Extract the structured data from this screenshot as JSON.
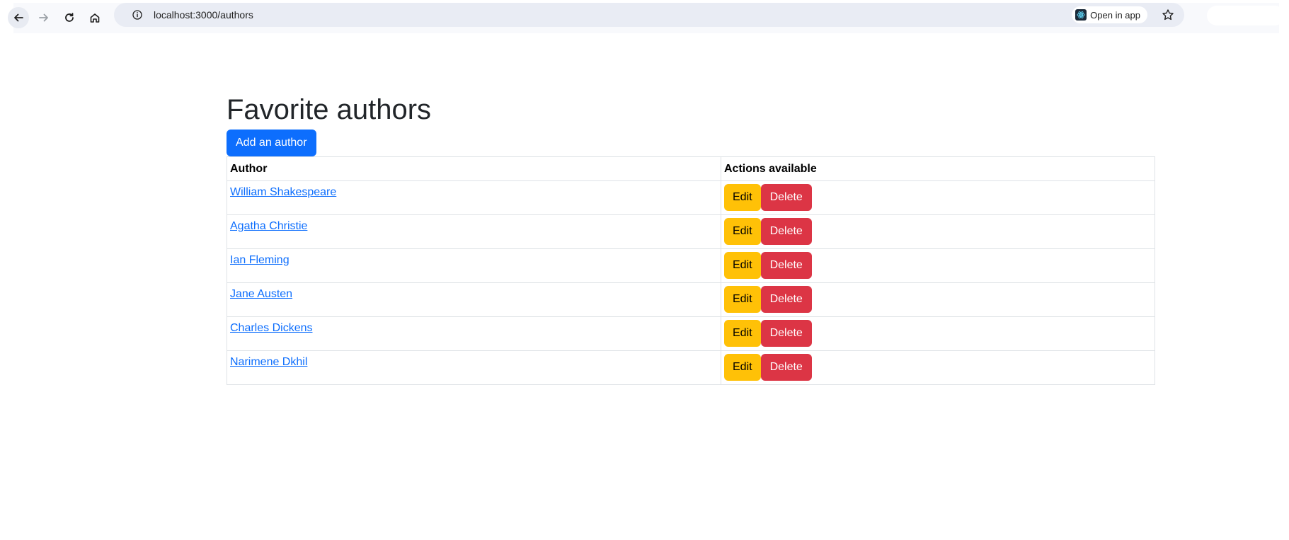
{
  "browser": {
    "url": "localhost:3000/authors",
    "open_in_app_label": "Open in app"
  },
  "page": {
    "title": "Favorite authors",
    "add_button_label": "Add an author"
  },
  "table": {
    "headers": [
      "Author",
      "Actions available"
    ],
    "rows": [
      {
        "author": "William Shakespeare",
        "edit": "Edit",
        "delete": "Delete"
      },
      {
        "author": "Agatha Christie",
        "edit": "Edit",
        "delete": "Delete"
      },
      {
        "author": "Ian Fleming",
        "edit": "Edit",
        "delete": "Delete"
      },
      {
        "author": "Jane Austen",
        "edit": "Edit",
        "delete": "Delete"
      },
      {
        "author": "Charles Dickens",
        "edit": "Edit",
        "delete": "Delete"
      },
      {
        "author": "Narimene Dkhil",
        "edit": "Edit",
        "delete": "Delete"
      }
    ]
  },
  "colors": {
    "primary": "#0d6efd",
    "warning": "#ffc107",
    "danger": "#dc3545"
  },
  "icons": {
    "back": "arrow-left-icon",
    "forward": "arrow-right-icon",
    "reload": "reload-icon",
    "home": "home-icon",
    "site_info": "info-icon",
    "open_in_app": "react-app-icon",
    "bookmark": "star-icon"
  }
}
